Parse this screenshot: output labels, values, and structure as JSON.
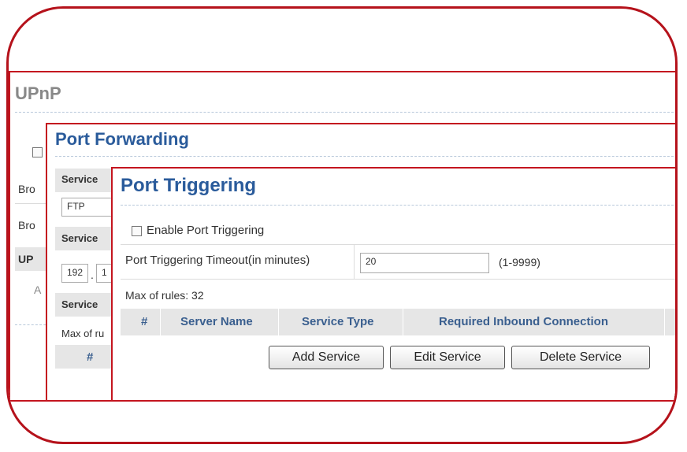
{
  "upnp": {
    "title": "UPnP",
    "row1": "Bro",
    "row2": "Bro",
    "row3": "UP",
    "row4": "A"
  },
  "port_forwarding": {
    "title": "Port Forwarding",
    "service_label": "Service",
    "service_value": "FTP",
    "service2_label": "Service",
    "ip_part1": "192",
    "ip_part2": "1",
    "service3_label": "Service",
    "max_rules": "Max of ru",
    "col_num": "#"
  },
  "port_triggering": {
    "title": "Port Triggering",
    "enable_label": "Enable Port Triggering",
    "enable_checked": false,
    "timeout_label": "Port Triggering Timeout(in minutes)",
    "timeout_value": "20",
    "timeout_range": "(1-9999)",
    "max_rules": "Max of rules: 32",
    "table": {
      "columns": [
        "#",
        "Server Name",
        "Service Type",
        "Required Inbound Connection"
      ]
    },
    "buttons": {
      "add": "Add Service",
      "edit": "Edit Service",
      "delete": "Delete Service"
    }
  },
  "colors": {
    "border_red": "#c4151f",
    "title_blue": "#2a5b9b",
    "title_gray": "#888888"
  }
}
